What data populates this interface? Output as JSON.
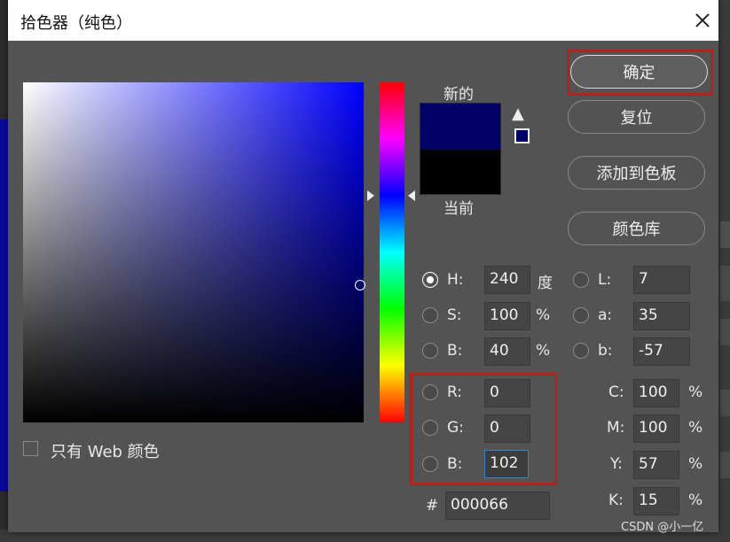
{
  "dialog": {
    "title": "拾色器（纯色）"
  },
  "swatches": {
    "new_label": "新的",
    "current_label": "当前",
    "new_color": "#000066",
    "current_color": "#000000"
  },
  "buttons": {
    "ok": "确定",
    "reset": "复位",
    "add_swatch": "添加到色板",
    "libraries": "颜色库"
  },
  "hsb": {
    "h_label": "H:",
    "h_value": "240",
    "h_unit": "度",
    "s_label": "S:",
    "s_value": "100",
    "s_unit": "%",
    "b_label": "B:",
    "b_value": "40",
    "b_unit": "%",
    "selected": "H"
  },
  "lab": {
    "l_label": "L:",
    "l_value": "7",
    "a_label": "a:",
    "a_value": "35",
    "b_label": "b:",
    "b_value": "-57"
  },
  "rgb": {
    "r_label": "R:",
    "r_value": "0",
    "g_label": "G:",
    "g_value": "0",
    "b_label": "B:",
    "b_value": "102"
  },
  "cmyk": {
    "c_label": "C:",
    "c_value": "100",
    "c_unit": "%",
    "m_label": "M:",
    "m_value": "100",
    "m_unit": "%",
    "y_label": "Y:",
    "y_value": "57",
    "y_unit": "%",
    "k_label": "K:",
    "k_value": "15",
    "k_unit": "%"
  },
  "hex": {
    "label": "#",
    "value": "000066"
  },
  "web_only": {
    "label": "只有 Web 颜色",
    "checked": false
  },
  "watermark": "CSDN @小一亿",
  "icons": {
    "warning": "warning-icon",
    "cube": "web-safe-cube-icon",
    "close": "close-icon"
  }
}
